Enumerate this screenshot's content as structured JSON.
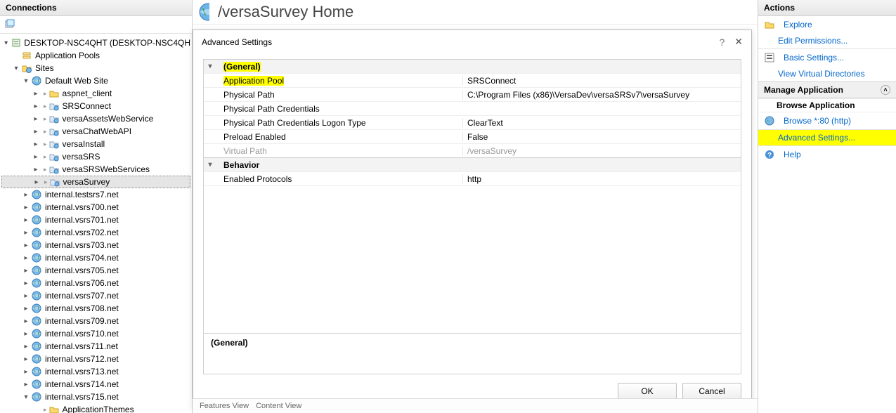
{
  "left": {
    "title": "Connections",
    "server": "DESKTOP-NSC4QHT (DESKTOP-NSC4QH",
    "appPools": "Application Pools",
    "sites": "Sites",
    "defaultSite": "Default Web Site",
    "vdirs": [
      "aspnet_client",
      "SRSConnect",
      "versaAssetsWebService",
      "versaChatWebAPI",
      "versaInstall",
      "versaSRS",
      "versaSRSWebServices",
      "versaSurvey"
    ],
    "selected": "versaSurvey",
    "otherSites": [
      "internal.testsrs7.net",
      "internal.vsrs700.net",
      "internal.vsrs701.net",
      "internal.vsrs702.net",
      "internal.vsrs703.net",
      "internal.vsrs704.net",
      "internal.vsrs705.net",
      "internal.vsrs706.net",
      "internal.vsrs707.net",
      "internal.vsrs708.net",
      "internal.vsrs709.net",
      "internal.vsrs710.net",
      "internal.vsrs711.net",
      "internal.vsrs712.net",
      "internal.vsrs713.net",
      "internal.vsrs714.net",
      "internal.vsrs715.net"
    ],
    "extraFolder": "ApplicationThemes"
  },
  "center": {
    "title": "/versaSurvey Home",
    "featuresView": "Features View",
    "contentView": "Content View",
    "dialog": {
      "title": "Advanced Settings",
      "general": "(General)",
      "rows": {
        "appPool": {
          "label": "Application Pool",
          "value": "SRSConnect"
        },
        "physPath": {
          "label": "Physical Path",
          "value": "C:\\Program Files (x86)\\VersaDev\\versaSRSv7\\versaSurvey"
        },
        "physCred": {
          "label": "Physical Path Credentials",
          "value": ""
        },
        "logonType": {
          "label": "Physical Path Credentials Logon Type",
          "value": "ClearText"
        },
        "preload": {
          "label": "Preload Enabled",
          "value": "False"
        },
        "vpath": {
          "label": "Virtual Path",
          "value": "/versaSurvey"
        }
      },
      "behavior": "Behavior",
      "enabledProt": {
        "label": "Enabled Protocols",
        "value": "http"
      },
      "descHeader": "(General)",
      "ok": "OK",
      "cancel": "Cancel",
      "help": "?"
    }
  },
  "right": {
    "title": "Actions",
    "explore": "Explore",
    "editPerms": "Edit Permissions...",
    "basicSettings": "Basic Settings...",
    "viewVdirs": "View Virtual Directories",
    "manageApp": "Manage Application",
    "browseApp": "Browse Application",
    "browse80": "Browse *:80 (http)",
    "advSettings": "Advanced Settings...",
    "help": "Help"
  }
}
